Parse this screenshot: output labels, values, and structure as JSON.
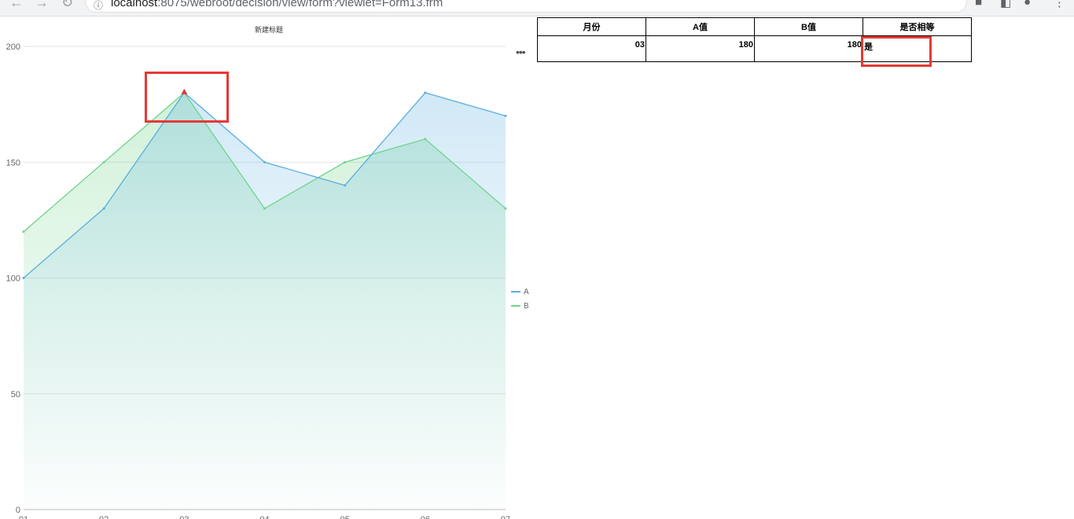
{
  "browser": {
    "url_host": "localhost",
    "url_rest": ":8075/webroot/decision/view/form?viewlet=Form13.frm"
  },
  "chart_data": {
    "type": "area",
    "title": "新建标题",
    "categories": [
      "01",
      "02",
      "03",
      "04",
      "05",
      "06",
      "07"
    ],
    "series": [
      {
        "name": "A",
        "values": [
          100,
          130,
          180,
          150,
          140,
          180,
          170
        ],
        "color": "#5aaee0"
      },
      {
        "name": "B",
        "values": [
          120,
          150,
          180,
          130,
          150,
          160,
          130
        ],
        "color": "#6fd48a"
      }
    ],
    "ylim": [
      0,
      200
    ],
    "yticks": [
      0,
      50,
      100,
      150,
      200
    ],
    "grid": true,
    "legend_position": "right",
    "highlight_point": {
      "category": "03",
      "value": 180
    }
  },
  "table": {
    "headers": [
      "月份",
      "A值",
      "B值",
      "是否相等"
    ],
    "rows": [
      {
        "month": "03",
        "a": "180",
        "b": "180",
        "equal": "是"
      }
    ]
  },
  "annotation_color": "#e53935"
}
